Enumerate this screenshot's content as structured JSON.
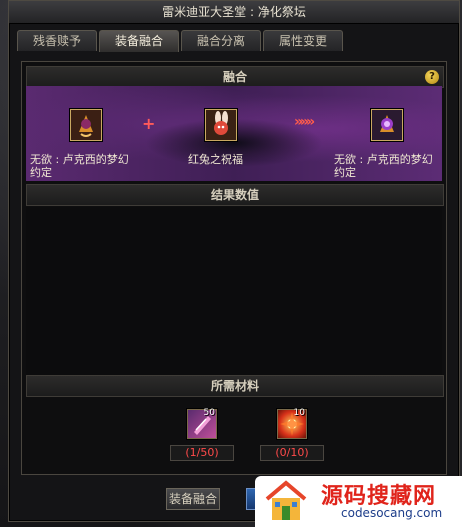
{
  "window": {
    "title": "雷米迪亚大圣堂 : 净化祭坛"
  },
  "tabs": [
    {
      "label": "残香赎予",
      "active": false
    },
    {
      "label": "装备融合",
      "active": true
    },
    {
      "label": "融合分离",
      "active": false
    },
    {
      "label": "属性变更",
      "active": false
    }
  ],
  "fusion": {
    "header": "融合",
    "help_icon": "question-mark-icon",
    "help_symbol": "?",
    "plus_symbol": "+",
    "arrow_symbol": "»»»",
    "items": [
      {
        "label": "无欲 : 卢克西的梦幻约定",
        "icon": "cloak-item-icon"
      },
      {
        "label": "红兔之祝福",
        "icon": "red-rabbit-item-icon"
      },
      {
        "label": "无欲 : 卢克西的梦幻约定",
        "icon": "purple-cloak-item-icon"
      }
    ]
  },
  "result": {
    "header": "结果数值"
  },
  "materials": {
    "header": "所需材料",
    "items": [
      {
        "icon": "purple-shard-icon",
        "count": "50",
        "progress": "(1/50)"
      },
      {
        "icon": "red-burst-icon",
        "count": "10",
        "progress": "(0/10)"
      }
    ]
  },
  "footer": {
    "fuse_button": "装备融合"
  },
  "watermark": {
    "title": "源码搜藏网",
    "url": "codesocang.com"
  },
  "colors": {
    "accent_gold": "#c9a861",
    "missing_red": "#ff4a4a",
    "fusion_purple": "#5a2a70",
    "watermark_red": "#e0241b"
  }
}
